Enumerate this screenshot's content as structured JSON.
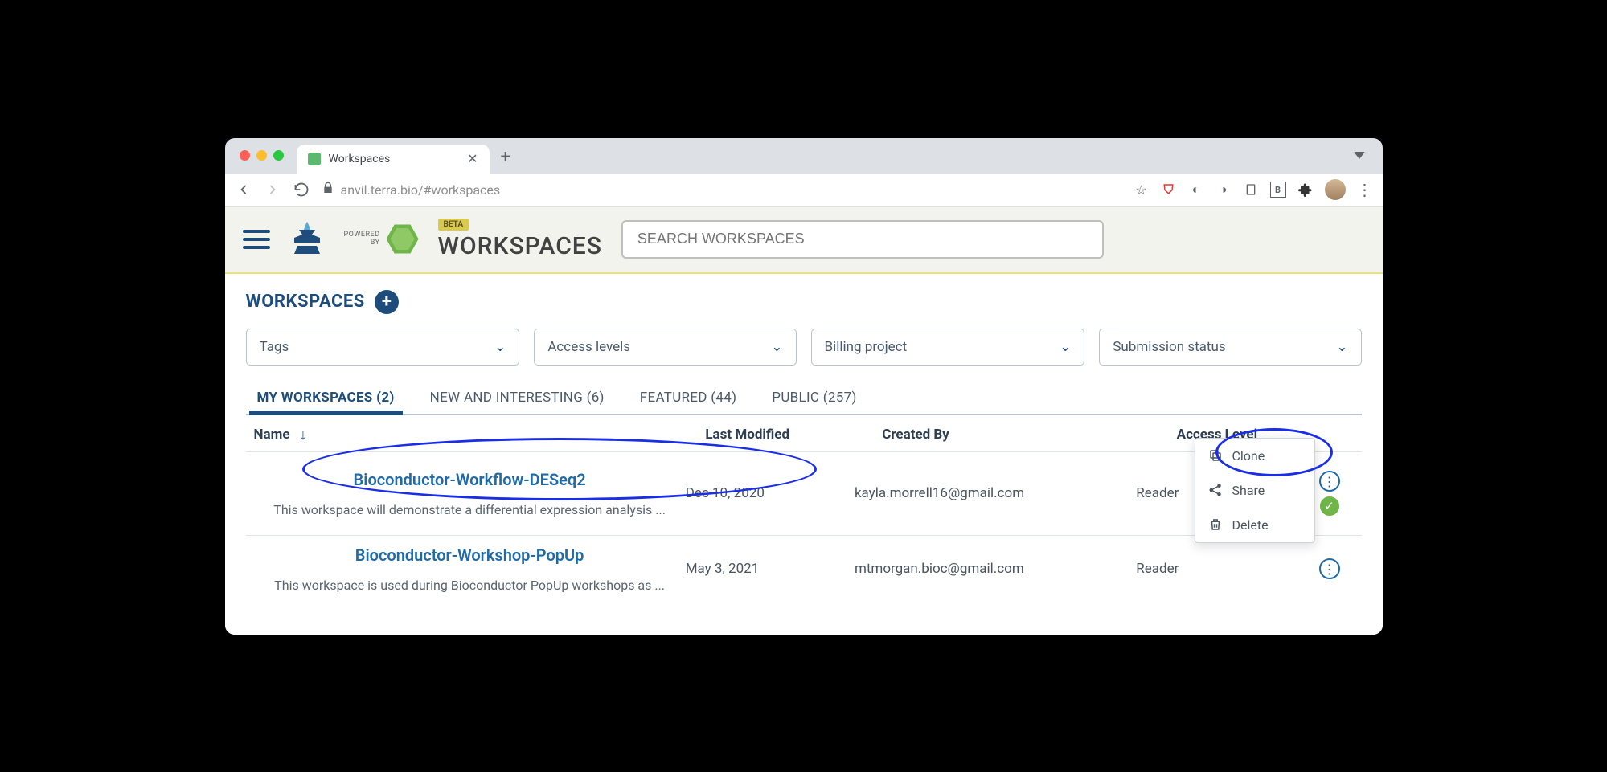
{
  "browser": {
    "tab_title": "Workspaces",
    "url_display": "anvil.terra.bio/#workspaces"
  },
  "header": {
    "powered_line1": "POWERED",
    "powered_line2": "BY",
    "beta": "BETA",
    "page_title": "WORKSPACES",
    "search_placeholder": "SEARCH WORKSPACES"
  },
  "section": {
    "heading": "WORKSPACES"
  },
  "filters": {
    "tags": "Tags",
    "access": "Access levels",
    "billing": "Billing project",
    "submission": "Submission status"
  },
  "tabs": {
    "my": "MY WORKSPACES (2)",
    "new": "NEW AND INTERESTING (6)",
    "featured": "FEATURED (44)",
    "public": "PUBLIC (257)"
  },
  "columns": {
    "name": "Name",
    "modified": "Last Modified",
    "created_by": "Created By",
    "access": "Access Level"
  },
  "rows": [
    {
      "name": "Bioconductor-Workflow-DESeq2",
      "desc": "This workspace will demonstrate a differential expression analysis ...",
      "modified": "Dec 10, 2020",
      "created_by": "kayla.morrell16@gmail.com",
      "access": "Reader"
    },
    {
      "name": "Bioconductor-Workshop-PopUp",
      "desc": "This workspace is used during Bioconductor PopUp workshops as ...",
      "modified": "May 3, 2021",
      "created_by": "mtmorgan.bioc@gmail.com",
      "access": "Reader"
    }
  ],
  "popup": {
    "clone": "Clone",
    "share": "Share",
    "delete": "Delete"
  }
}
